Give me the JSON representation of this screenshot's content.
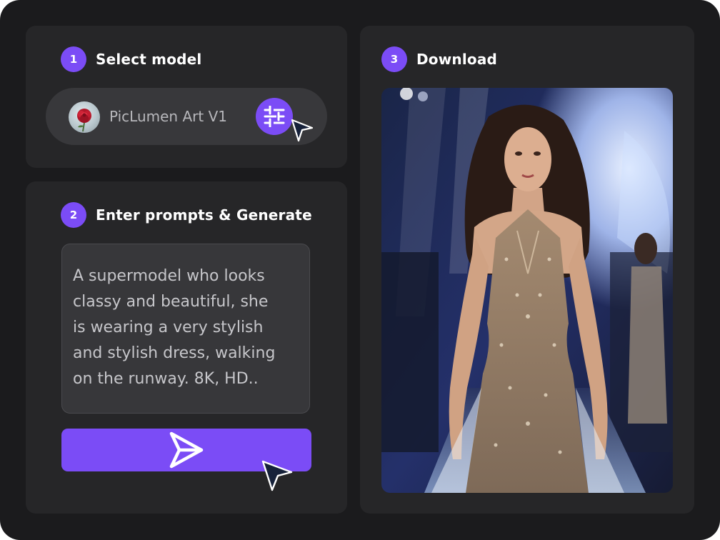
{
  "steps": [
    {
      "number": "1",
      "title": "Select model"
    },
    {
      "number": "2",
      "title": "Enter prompts & Generate"
    },
    {
      "number": "3",
      "title": "Download"
    }
  ],
  "model": {
    "name": "PicLumen Art V1",
    "avatar_icon": "rose-icon",
    "settings_icon": "sliders-icon"
  },
  "prompt": {
    "text": "A supermodel who looks\nclassy and beautiful, she\nis wearing a very stylish\nand stylish dress, walking\non the runway. 8K, HD.."
  },
  "generate_button": {
    "icon": "send-icon"
  },
  "colors": {
    "accent": "#7b4cf6",
    "background": "#1b1b1d",
    "card": "#262628"
  }
}
